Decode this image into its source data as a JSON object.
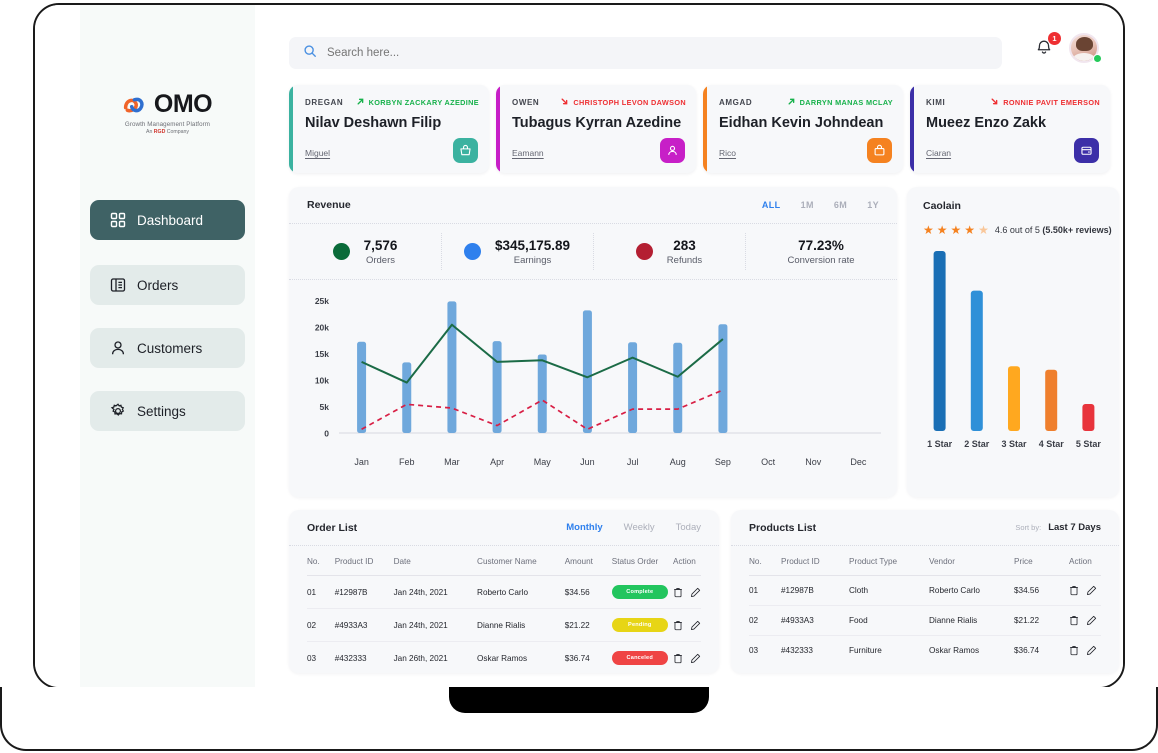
{
  "sidebar": {
    "logo": {
      "text": "OMO",
      "tagline": "Growth Management Platform",
      "company_prefix": "An ",
      "company_brand": "RGD",
      "company_suffix": " Company"
    },
    "items": [
      {
        "label": "Dashboard",
        "icon": "grid-icon",
        "active": true
      },
      {
        "label": "Orders",
        "icon": "list-icon",
        "active": false
      },
      {
        "label": "Customers",
        "icon": "user-icon",
        "active": false
      },
      {
        "label": "Settings",
        "icon": "gear-icon",
        "active": false
      }
    ],
    "active_color": "#3f6265",
    "inactive_bg": "#e3ebea"
  },
  "header": {
    "search_placeholder": "Search here...",
    "search_value": "",
    "notification_count": "1",
    "notification_color": "#ee2f32",
    "online_color": "#25c95a"
  },
  "person_cards": [
    {
      "label": "DREGAN",
      "trend_text": "KORBYN ZACKARY AZEDINE",
      "trend_dir": "up",
      "name": "Nilav Deshawn Filip",
      "sub": "Miguel",
      "accent": "#3bb2a0",
      "icon": "basket-icon"
    },
    {
      "label": "OWEN",
      "trend_text": "CHRISTOPH LEVON DAWSON",
      "trend_dir": "down",
      "name": "Tubagus Kyrran Azedine",
      "sub": "Eamann",
      "accent": "#c71fc7",
      "icon": "person-icon"
    },
    {
      "label": "AMGAD",
      "trend_text": "DARRYN MANAS MCLAY",
      "trend_dir": "up",
      "name": "Eidhan Kevin Johndean",
      "sub": "Rico",
      "accent": "#f58220",
      "icon": "bag-icon"
    },
    {
      "label": "KIMI",
      "trend_text": "RONNIE PAVIT EMERSON",
      "trend_dir": "down",
      "name": "Mueez Enzo Zakk",
      "sub": "Ciaran",
      "accent": "#3c2fa8",
      "icon": "wallet-icon"
    }
  ],
  "revenue": {
    "title": "Revenue",
    "ranges": [
      {
        "label": "ALL",
        "active": true
      },
      {
        "label": "1M",
        "active": false
      },
      {
        "label": "6M",
        "active": false
      },
      {
        "label": "1Y",
        "active": false
      }
    ],
    "stats": [
      {
        "value": "7,576",
        "label": "Orders",
        "color": "#0a6b39"
      },
      {
        "value": "$345,175.89",
        "label": "Earnings",
        "color": "#2f80ed"
      },
      {
        "value": "283",
        "label": "Refunds",
        "color": "#b41f32"
      },
      {
        "value": "77.23%",
        "label": "Conversion rate",
        "color": ""
      }
    ]
  },
  "rating": {
    "title": "Caolain",
    "stars_full": 4,
    "stars_half": 1,
    "score_text": "4.6 out of 5 ",
    "reviews_text": "(5.50k+ reviews)",
    "star_color": "#f58220"
  },
  "order_list": {
    "title": "Order List",
    "tabs": [
      {
        "label": "Monthly",
        "active": true
      },
      {
        "label": "Weekly",
        "active": false
      },
      {
        "label": "Today",
        "active": false
      }
    ],
    "columns": [
      "No.",
      "Product ID",
      "Date",
      "Customer Name",
      "Amount",
      "Status Order",
      "Action"
    ],
    "rows": [
      {
        "no": "01",
        "product_id": "#12987B",
        "date": "Jan 24th, 2021",
        "customer": "Roberto Carlo",
        "amount": "$34.56",
        "status": "Complete",
        "status_color": "#22c55e"
      },
      {
        "no": "02",
        "product_id": "#4933A3",
        "date": "Jan 24th, 2021",
        "customer": "Dianne Rialis",
        "amount": "$21.22",
        "status": "Pending",
        "status_color": "#e7d516"
      },
      {
        "no": "03",
        "product_id": "#432333",
        "date": "Jan 26th, 2021",
        "customer": "Oskar Ramos",
        "amount": "$36.74",
        "status": "Canceled",
        "status_color": "#ef4444"
      }
    ]
  },
  "products_list": {
    "title": "Products List",
    "sort_label": "Sort by:",
    "sort_value": "Last 7 Days",
    "columns": [
      "No.",
      "Product ID",
      "Product Type",
      "Vendor",
      "Price",
      "Action"
    ],
    "rows": [
      {
        "no": "01",
        "product_id": "#12987B",
        "type": "Cloth",
        "vendor": "Roberto Carlo",
        "price": "$34.56"
      },
      {
        "no": "02",
        "product_id": "#4933A3",
        "type": "Food",
        "vendor": "Dianne Rialis",
        "price": "$21.22"
      },
      {
        "no": "03",
        "product_id": "#432333",
        "type": "Furniture",
        "vendor": "Oskar Ramos",
        "price": "$36.74"
      }
    ]
  },
  "chart_data": [
    {
      "type": "bar",
      "title": "Revenue",
      "categories": [
        "Jan",
        "Feb",
        "Mar",
        "Apr",
        "May",
        "Jun",
        "Jul",
        "Aug",
        "Sep",
        "Oct",
        "Nov",
        "Dec"
      ],
      "ylabel": "",
      "xlabel": "",
      "ylim": [
        0,
        26000
      ],
      "yticks": [
        0,
        5000,
        10000,
        15000,
        20000,
        25000
      ],
      "ytick_labels": [
        "0",
        "5k",
        "10k",
        "15k",
        "20k",
        "25k"
      ],
      "grid": false,
      "series": [
        {
          "name": "Orders bars",
          "kind": "bar",
          "color": "#6fa8dc",
          "values": [
            17200,
            13300,
            24800,
            17300,
            14800,
            23100,
            17100,
            17000,
            20500,
            null,
            null,
            null
          ]
        },
        {
          "name": "Earnings",
          "kind": "line",
          "color": "#1b6b46",
          "values": [
            13400,
            9500,
            20400,
            13400,
            13700,
            10500,
            14200,
            10600,
            17700,
            null,
            null,
            null
          ]
        },
        {
          "name": "Refunds",
          "kind": "line-dashed",
          "color": "#d81f45",
          "values": [
            700,
            5400,
            4700,
            1400,
            6200,
            700,
            4500,
            4500,
            8100,
            null,
            null,
            null
          ]
        }
      ]
    },
    {
      "type": "bar",
      "title": "Caolain ratings",
      "categories": [
        "1 Star",
        "2 Star",
        "3 Star",
        "4 Star",
        "5 Star"
      ],
      "values": [
        100,
        78,
        36,
        34,
        15
      ],
      "ylim": [
        0,
        100
      ],
      "colors": [
        "#1a6fb5",
        "#2f90d8",
        "#ffa81f",
        "#ef7f2d",
        "#e8343c"
      ],
      "grid": false,
      "xlabel": "",
      "ylabel": ""
    }
  ]
}
